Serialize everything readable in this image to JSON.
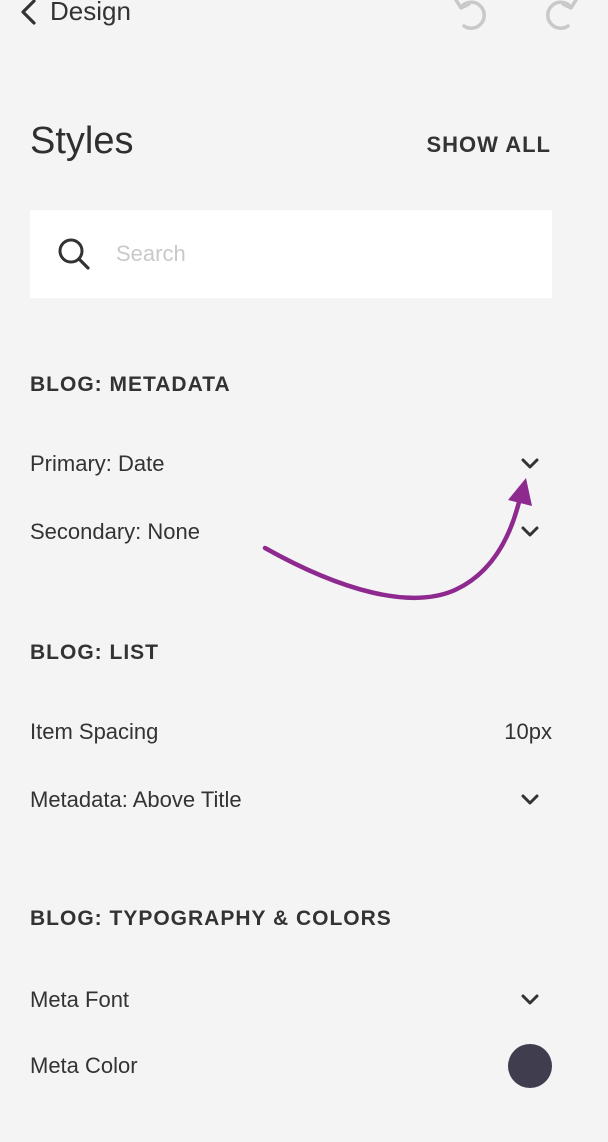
{
  "header": {
    "back_label": "Design"
  },
  "page": {
    "title": "Styles",
    "show_all_label": "SHOW ALL"
  },
  "search": {
    "placeholder": "Search",
    "value": ""
  },
  "sections": {
    "metadata": {
      "title": "BLOG: METADATA",
      "primary": "Primary: Date",
      "secondary": "Secondary: None"
    },
    "list": {
      "title": "BLOG: LIST",
      "item_spacing_label": "Item Spacing",
      "item_spacing_value": "10px",
      "metadata_label": "Metadata: Above Title"
    },
    "typography": {
      "title": "BLOG: TYPOGRAPHY & COLORS",
      "meta_font_label": "Meta Font",
      "meta_color_label": "Meta Color",
      "meta_color_value": "#3f3d4e"
    }
  },
  "colors": {
    "background": "#f4f4f4",
    "text": "#333333",
    "annotation_arrow": "#8e2a8f"
  }
}
